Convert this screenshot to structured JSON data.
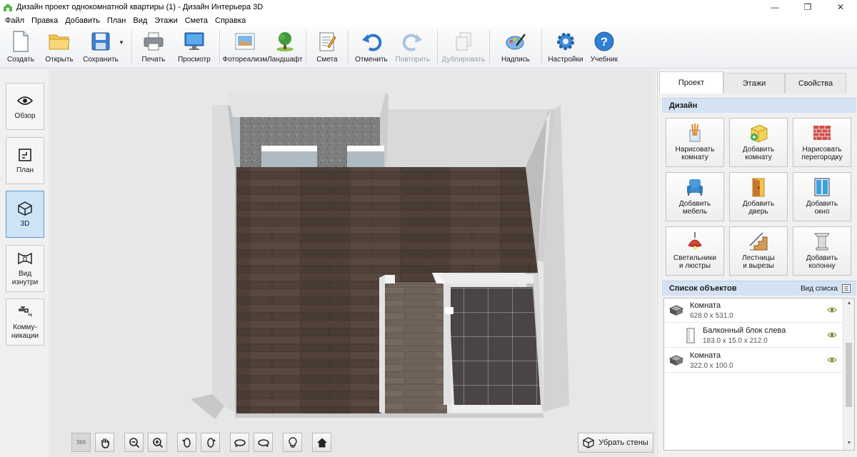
{
  "window": {
    "title": "Дизайн проект однокомнатной квартиры (1) - Дизайн Интерьера 3D",
    "controls": {
      "minimize": "—",
      "maximize": "❐",
      "close": "✕"
    }
  },
  "menu": [
    "Файл",
    "Правка",
    "Добавить",
    "План",
    "Вид",
    "Этажи",
    "Смета",
    "Справка"
  ],
  "toolbar": {
    "create": "Создать",
    "open": "Открыть",
    "save": "Сохранить",
    "print": "Печать",
    "preview": "Просмотр",
    "photorealism": "Фотореализм",
    "landscape": "Ландшафт",
    "estimate": "Смета",
    "undo": "Отменить",
    "redo": "Повторить",
    "duplicate": "Дублировать",
    "caption": "Надпись",
    "settings": "Настройки",
    "tutorial": "Учебник"
  },
  "left_panel": {
    "overview": "Обзор",
    "plan": "План",
    "view3d": "3D",
    "inside_line1": "Вид",
    "inside_line2": "изнутри",
    "comm_line1": "Комму-",
    "comm_line2": "никации",
    "active": "3D"
  },
  "bottom": {
    "rotate_360": "360",
    "remove_walls": "Убрать стены"
  },
  "right_panel": {
    "tabs": {
      "project": "Проект",
      "floors": "Этажи",
      "properties": "Свойства"
    },
    "active_tab": "Проект",
    "design_header": "Дизайн",
    "design_buttons": [
      {
        "line1": "Нарисовать",
        "line2": "комнату",
        "icon": "draw-room-icon"
      },
      {
        "line1": "Добавить",
        "line2": "комнату",
        "icon": "add-room-icon"
      },
      {
        "line1": "Нарисовать",
        "line2": "перегородку",
        "icon": "brick-wall-icon"
      },
      {
        "line1": "Добавить",
        "line2": "мебель",
        "icon": "armchair-icon"
      },
      {
        "line1": "Добавить",
        "line2": "дверь",
        "icon": "door-icon"
      },
      {
        "line1": "Добавить",
        "line2": "окно",
        "icon": "window-icon"
      },
      {
        "line1": "Светильники",
        "line2": "и люстры",
        "icon": "lamp-icon"
      },
      {
        "line1": "Лестницы",
        "line2": "и вырезы",
        "icon": "stairs-icon"
      },
      {
        "line1": "Добавить",
        "line2": "колонну",
        "icon": "column-icon"
      }
    ],
    "objects_header": "Список объектов",
    "view_list": "Вид списка",
    "objects": [
      {
        "name": "Комната",
        "dims": "628.0 x 531.0"
      },
      {
        "name": "Балконный блок слева",
        "dims": "183.0 x 15.0 x 212.0"
      },
      {
        "name": "Комната",
        "dims": "322.0 x 100.0"
      }
    ]
  },
  "colors": {
    "accent": "#5a9bd5",
    "section_header": "#d4e3f3",
    "floor_wood": "#4f4139",
    "floor_tile": "#4a4446",
    "wall_top": "#dedede"
  }
}
